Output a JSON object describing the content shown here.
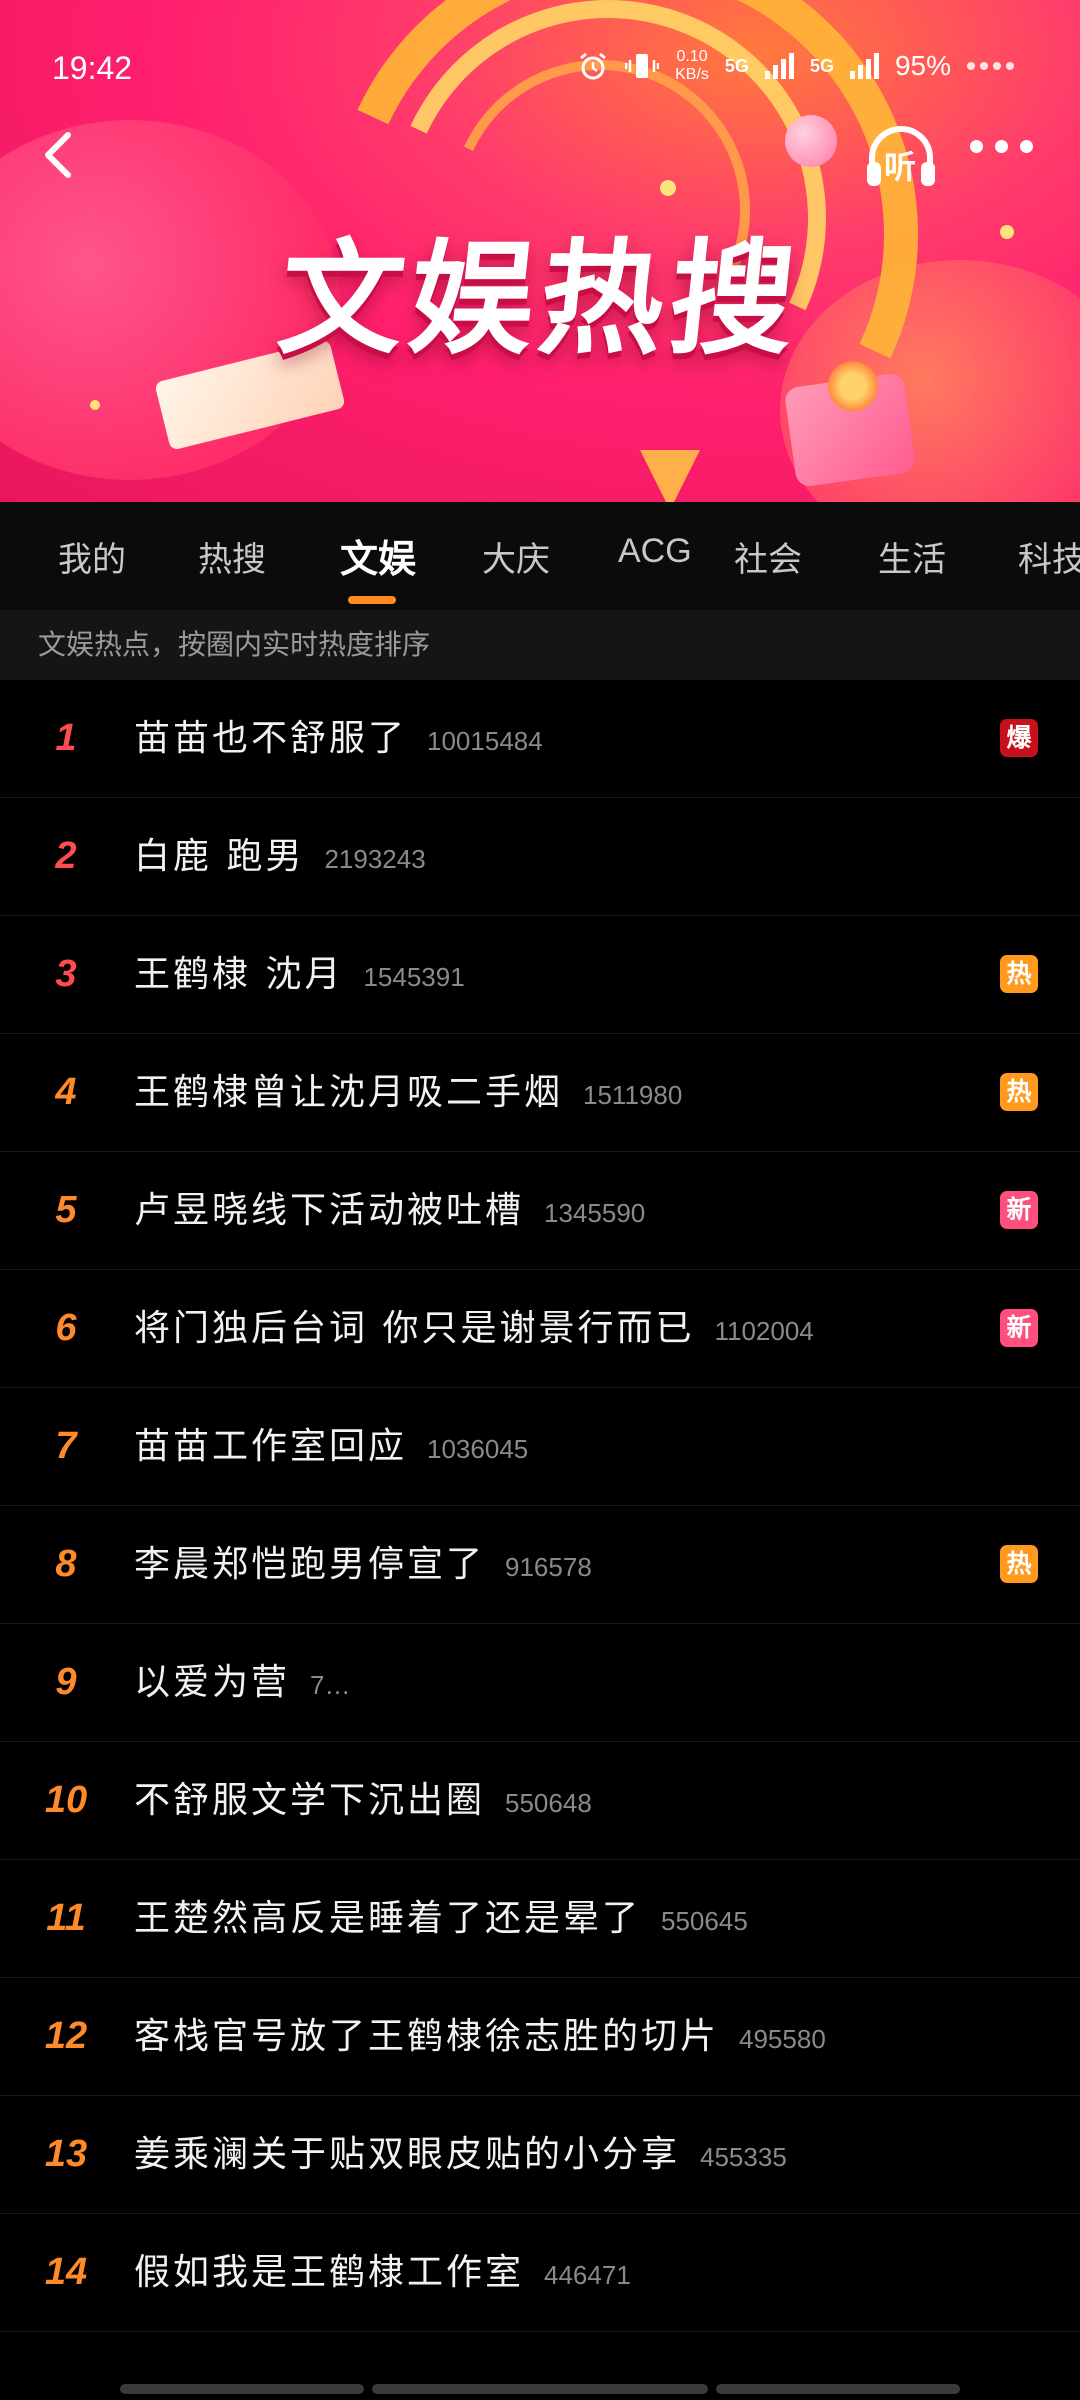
{
  "status_bar": {
    "time": "19:42",
    "net_speed_top": "0.10",
    "net_speed_bottom": "KB/s",
    "network_1": "5G",
    "network_2": "5G",
    "battery": "95%"
  },
  "header": {
    "banner_title": "文娱热搜",
    "listen_label": "听",
    "back_icon": "chevron-left-icon",
    "more_icon": "more-dots-icon"
  },
  "tabs": [
    "我的",
    "热搜",
    "文娱",
    "大庆",
    "ACG",
    "社会",
    "生活",
    "科技"
  ],
  "active_tab": "文娱",
  "hint": "文娱热点，按圈内实时热度排序",
  "list": [
    {
      "rank": "1",
      "title": "苗苗也不舒服了",
      "count": "10015484",
      "badge": "爆"
    },
    {
      "rank": "2",
      "title": "白鹿 跑男",
      "count": "2193243",
      "badge": ""
    },
    {
      "rank": "3",
      "title": "王鹤棣 沈月",
      "count": "1545391",
      "badge": "热"
    },
    {
      "rank": "4",
      "title": "王鹤棣曾让沈月吸二手烟",
      "count": "1511980",
      "badge": "热"
    },
    {
      "rank": "5",
      "title": "卢昱晓线下活动被吐槽",
      "count": "1345590",
      "badge": "新"
    },
    {
      "rank": "6",
      "title": "将门独后台词 你只是谢景行而已",
      "count": "1102004",
      "badge": "新"
    },
    {
      "rank": "7",
      "title": "苗苗工作室回应",
      "count": "1036045",
      "badge": ""
    },
    {
      "rank": "8",
      "title": "李晨郑恺跑男停宣了",
      "count": "916578",
      "badge": "热"
    },
    {
      "rank": "9",
      "title": "以爱为营",
      "count": "7…",
      "badge": ""
    },
    {
      "rank": "10",
      "title": "不舒服文学下沉出圈",
      "count": "550648",
      "badge": ""
    },
    {
      "rank": "11",
      "title": "王楚然高反是睡着了还是晕了",
      "count": "550645",
      "badge": ""
    },
    {
      "rank": "12",
      "title": "客栈官号放了王鹤棣徐志胜的切片",
      "count": "495580",
      "badge": ""
    },
    {
      "rank": "13",
      "title": "姜乘澜关于贴双眼皮贴的小分享",
      "count": "455335",
      "badge": ""
    },
    {
      "rank": "14",
      "title": "假如我是王鹤棣工作室",
      "count": "446471",
      "badge": ""
    }
  ],
  "badge_colors": {
    "爆": "#c8101c",
    "热": "#ff9a1f",
    "新": "#ff4f7e"
  },
  "rank_colors": {
    "top": "#ff4d4f",
    "mid": "#ff8a2a"
  }
}
